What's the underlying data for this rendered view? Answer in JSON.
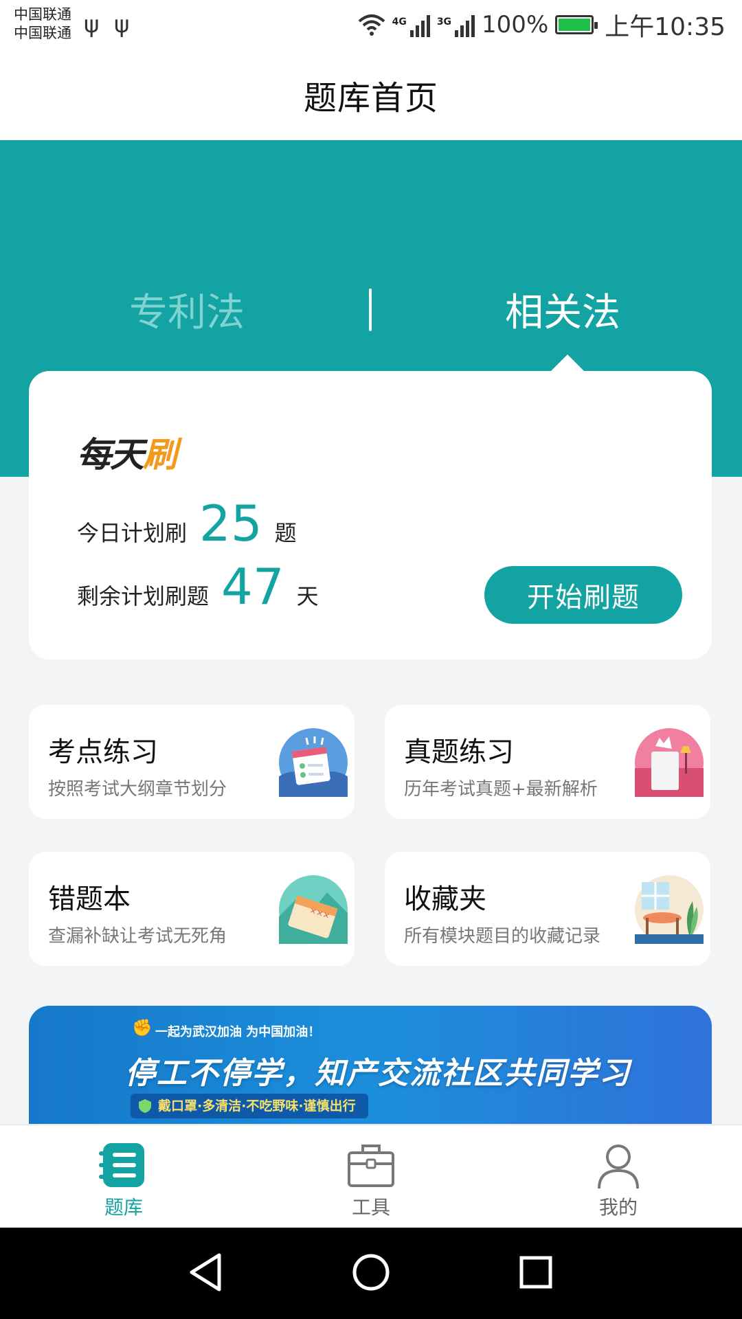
{
  "status_bar": {
    "carrier1": "中国联通",
    "carrier2": "中国联通",
    "usb_icon": "usb-icon",
    "net1": "4G",
    "net2": "3G",
    "battery": "100%",
    "time": "上午10:35"
  },
  "header": {
    "title": "题库首页"
  },
  "subject_tabs": [
    {
      "label": "专利法",
      "active": false
    },
    {
      "label": "相关法",
      "active": true
    }
  ],
  "daily": {
    "logo_dark": "每天",
    "logo_orange": "刷",
    "today_prefix": "今日计划刷",
    "today_count": "25",
    "today_suffix": "题",
    "remain_prefix": "剩余计划刷题",
    "remain_days": "47",
    "remain_suffix": "天",
    "start_button": "开始刷题"
  },
  "features": [
    {
      "title": "考点练习",
      "desc": "按照考试大纲章节划分",
      "icon": "calendar-checklist-icon"
    },
    {
      "title": "真题练习",
      "desc": "历年考试真题+最新解析",
      "icon": "lamp-paper-icon"
    },
    {
      "title": "错题本",
      "desc": "查漏补缺让考试无死角",
      "icon": "notebook-mountain-icon"
    },
    {
      "title": "收藏夹",
      "desc": "所有模块题目的收藏记录",
      "icon": "table-plant-icon"
    }
  ],
  "banner": {
    "subtitle": "一起为武汉加油 为中国加油！",
    "main": "停工不停学，知产交流社区共同学习",
    "tag": "戴口罩·多清洁·不吃野味·谨慎出行"
  },
  "bottom_nav": [
    {
      "label": "题库",
      "active": true,
      "icon": "question-bank-icon"
    },
    {
      "label": "工具",
      "active": false,
      "icon": "toolbox-icon"
    },
    {
      "label": "我的",
      "active": false,
      "icon": "user-icon"
    }
  ],
  "colors": {
    "accent": "#12a3a2",
    "orange": "#f39a1d",
    "background": "#f3f4f6"
  }
}
